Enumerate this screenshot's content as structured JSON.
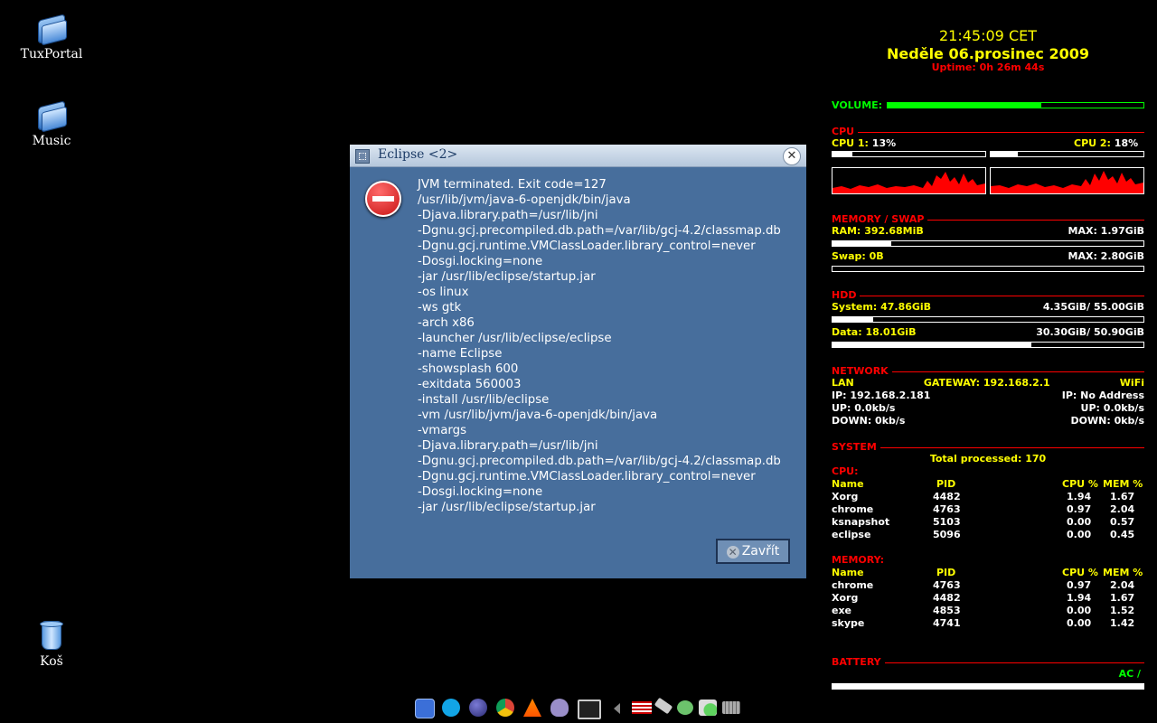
{
  "desktop": {
    "icons": [
      {
        "label": "TuxPortal"
      },
      {
        "label": "Music"
      },
      {
        "label": "Koš"
      }
    ]
  },
  "dialog": {
    "title": "Eclipse <2>",
    "message": "JVM terminated. Exit code=127\n/usr/lib/jvm/java-6-openjdk/bin/java\n-Djava.library.path=/usr/lib/jni\n-Dgnu.gcj.precompiled.db.path=/var/lib/gcj-4.2/classmap.db\n-Dgnu.gcj.runtime.VMClassLoader.library_control=never\n-Dosgi.locking=none\n-jar /usr/lib/eclipse/startup.jar\n-os linux\n-ws gtk\n-arch x86\n-launcher /usr/lib/eclipse/eclipse\n-name Eclipse\n-showsplash 600\n-exitdata 560003\n-install /usr/lib/eclipse\n-vm /usr/lib/jvm/java-6-openjdk/bin/java\n-vmargs\n-Djava.library.path=/usr/lib/jni\n-Dgnu.gcj.precompiled.db.path=/var/lib/gcj-4.2/classmap.db\n-Dgnu.gcj.runtime.VMClassLoader.library_control=never\n-Dosgi.locking=none\n-jar /usr/lib/eclipse/startup.jar",
    "close_label": "Zavřít"
  },
  "conky": {
    "time": "21:45:09 CET",
    "date": "Neděle 06.prosinec 2009",
    "uptime": "Uptime: 0h 26m 44s",
    "volume_label": "VOLUME:",
    "volume_level": 0.6,
    "cpu": {
      "heading": "CPU",
      "cpu1_label": "CPU 1:",
      "cpu1_value": "13%",
      "cpu1_level": 0.13,
      "cpu2_label": "CPU 2:",
      "cpu2_value": "18%",
      "cpu2_level": 0.18
    },
    "memory": {
      "heading": "MEMORY / SWAP",
      "ram_label": "RAM:",
      "ram_value": "392.68MiB",
      "ram_max": "MAX: 1.97GiB",
      "ram_level": 0.19,
      "swap_label": "Swap:",
      "swap_value": "0B",
      "swap_max": "MAX: 2.80GiB",
      "swap_level": 0.0
    },
    "hdd": {
      "heading": "HDD",
      "system_label": "System:",
      "system_value": "47.86GiB",
      "system_usage": "4.35GiB/ 55.00GiB",
      "system_level": 0.13,
      "data_label": "Data:",
      "data_value": "18.01GiB",
      "data_usage": "30.30GiB/ 50.90GiB",
      "data_level": 0.64
    },
    "network": {
      "heading": "NETWORK",
      "lan": "LAN",
      "gateway": "GATEWAY: 192.168.2.1",
      "wifi": "WiFi",
      "ip_lan": "IP: 192.168.2.181",
      "ip_wifi": "IP: No Address",
      "up_lan": "UP: 0.0kb/s",
      "up_wifi": "UP: 0.0kb/s",
      "down_lan": "DOWN: 0kb/s",
      "down_wifi": "DOWN: 0kb/s"
    },
    "system": {
      "heading": "SYSTEM",
      "total": "Total processed: 170",
      "cpu_heading": "CPU:",
      "mem_heading": "MEMORY:",
      "col_name": "Name",
      "col_pid": "PID",
      "col_cpu": "CPU %",
      "col_mem": "MEM %",
      "cpu_procs": [
        {
          "name": "Xorg",
          "pid": "4482",
          "cpu": "1.94",
          "mem": "1.67"
        },
        {
          "name": "chrome",
          "pid": "4763",
          "cpu": "0.97",
          "mem": "2.04"
        },
        {
          "name": "ksnapshot",
          "pid": "5103",
          "cpu": "0.00",
          "mem": "0.57"
        },
        {
          "name": "eclipse",
          "pid": "5096",
          "cpu": "0.00",
          "mem": "0.45"
        }
      ],
      "mem_procs": [
        {
          "name": "chrome",
          "pid": "4763",
          "cpu": "0.97",
          "mem": "2.04"
        },
        {
          "name": "Xorg",
          "pid": "4482",
          "cpu": "1.94",
          "mem": "1.67"
        },
        {
          "name": "exe",
          "pid": "4853",
          "cpu": "0.00",
          "mem": "1.52"
        },
        {
          "name": "skype",
          "pid": "4741",
          "cpu": "0.00",
          "mem": "1.42"
        }
      ]
    },
    "battery": {
      "heading": "BATTERY",
      "status": "AC /",
      "level": 1.0
    }
  },
  "colors": {
    "conky_yellow": "#ffff00",
    "conky_red": "#ff0000",
    "conky_green": "#00ff00",
    "dialog_bg": "#476e9c"
  },
  "taskbar": {
    "icons": [
      "kde-menu-icon",
      "skype-icon",
      "eclipse-icon",
      "chrome-icon",
      "vlc-icon",
      "pidgin-icon",
      "terminal-icon",
      "tray-arrow-icon",
      "us-flag-icon",
      "usb-icon",
      "network-icon",
      "chat-icon",
      "keyboard-icon"
    ]
  }
}
